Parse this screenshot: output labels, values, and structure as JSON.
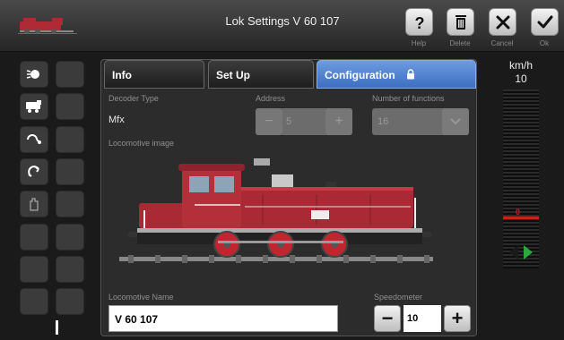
{
  "window": {
    "title": "Lok Settings V 60 107"
  },
  "toolbar": {
    "help_label": "Help",
    "delete_label": "Delete",
    "cancel_label": "Cancel",
    "ok_label": "Ok"
  },
  "tabs": [
    {
      "label": "Info"
    },
    {
      "label": "Set Up"
    },
    {
      "label": "Configuration",
      "locked": true
    }
  ],
  "config": {
    "decoder_type_label": "Decoder Type",
    "decoder_type_value": "Mfx",
    "address_label": "Address",
    "address_value": "5",
    "functions_label": "Number of functions",
    "functions_value": "16",
    "image_label": "Locomotive image",
    "name_label": "Locomotive Name",
    "name_value": "V 60 107",
    "speedometer_label": "Speedometer",
    "speedometer_value": "10"
  },
  "speed": {
    "unit": "km/h",
    "value": "10",
    "level": 0.1,
    "indicator_value": "0"
  },
  "colors": {
    "accent": "#4a7fd0",
    "direction_active": "#2ba83c",
    "speed_indicator": "#c62020",
    "loco_body": "#a92a35"
  }
}
